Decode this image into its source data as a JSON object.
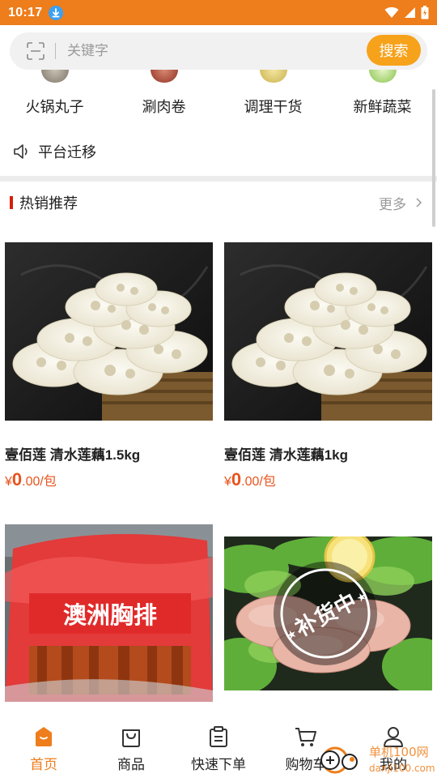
{
  "status_bar": {
    "time": "10:17"
  },
  "search": {
    "placeholder": "关键字",
    "button_label": "搜索"
  },
  "categories": [
    {
      "label": "火锅丸子"
    },
    {
      "label": "涮肉卷"
    },
    {
      "label": "调理干货"
    },
    {
      "label": "新鲜蔬菜"
    }
  ],
  "notice": {
    "text": "平台迁移"
  },
  "section": {
    "title": "热销推荐",
    "more_label": "更多"
  },
  "products": [
    {
      "name": "壹佰莲 清水莲藕1.5kg",
      "price_currency": "¥",
      "price_integer": "0",
      "price_decimal": ".00",
      "unit": "/包"
    },
    {
      "name": "壹佰莲 清水莲藕1kg",
      "price_currency": "¥",
      "price_integer": "0",
      "price_decimal": ".00",
      "unit": "/包"
    },
    {
      "image_text": "澳洲胸排"
    },
    {
      "image_stamp_text": "补货中"
    }
  ],
  "bottom_nav": [
    {
      "label": "首页",
      "icon": "home-icon",
      "active": true
    },
    {
      "label": "商品",
      "icon": "shopping-bag-icon",
      "active": false
    },
    {
      "label": "快速下单",
      "icon": "clipboard-icon",
      "active": false
    },
    {
      "label": "购物车",
      "icon": "cart-icon",
      "active": false
    },
    {
      "label": "我的",
      "icon": "user-icon",
      "active": false
    }
  ],
  "watermark": {
    "text": "单机100网",
    "sub_text": "danji100.com"
  },
  "colors": {
    "accent": "#ee7d1b",
    "search_button": "#f7a21b",
    "price": "#e8541e",
    "section_mark": "#d81e06"
  }
}
